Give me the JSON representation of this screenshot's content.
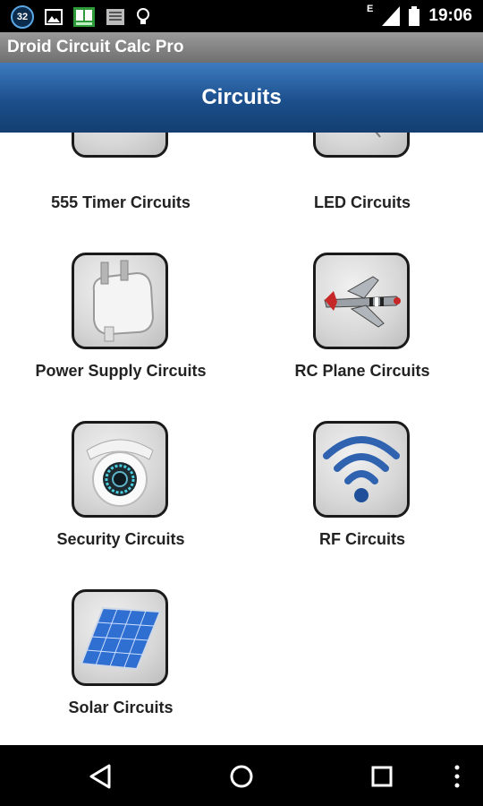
{
  "status_bar": {
    "notification_badge": "32",
    "network_type": "E",
    "time": "19:06"
  },
  "app": {
    "title": "Droid Circuit Calc Pro"
  },
  "header": {
    "title": "Circuits"
  },
  "tiles": [
    {
      "label": "555 Timer Circuits",
      "icon": "timer-icon"
    },
    {
      "label": "LED Circuits",
      "icon": "led-icon"
    },
    {
      "label": "Power Supply Circuits",
      "icon": "power-plug-icon"
    },
    {
      "label": "RC Plane Circuits",
      "icon": "rc-plane-icon"
    },
    {
      "label": "Security Circuits",
      "icon": "security-camera-icon"
    },
    {
      "label": "RF Circuits",
      "icon": "wifi-signal-icon"
    },
    {
      "label": "Solar Circuits",
      "icon": "solar-panel-icon"
    }
  ],
  "nav": {
    "back": "back-icon",
    "home": "home-icon",
    "recents": "recents-icon",
    "menu": "overflow-menu-icon"
  }
}
